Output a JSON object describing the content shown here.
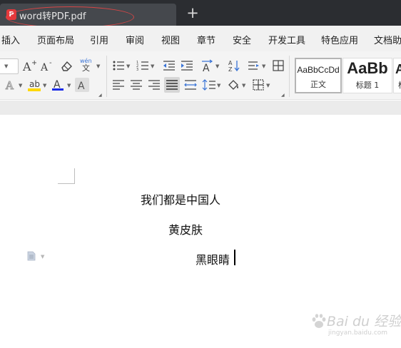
{
  "tab": {
    "icon_label": "P",
    "title": "word转PDF.pdf",
    "new_tab_symbol": "+"
  },
  "menu": [
    "插入",
    "页面布局",
    "引用",
    "审阅",
    "视图",
    "章节",
    "安全",
    "开发工具",
    "特色应用",
    "文档助手"
  ],
  "toolbar": {
    "phonetic_label": "wén",
    "styles": [
      {
        "preview": "AaBbCcDd",
        "name": "正文"
      },
      {
        "preview": "AaBb",
        "name": "标题 1"
      },
      {
        "preview": "Aa",
        "name": "标"
      }
    ]
  },
  "document": {
    "paragraphs": [
      "我们都是中国人",
      "黄皮肤",
      "黑眼睛"
    ]
  },
  "watermark": {
    "text": "Bai du 经验",
    "url": "jingyan.baidu.com"
  },
  "colors": {
    "tab_bar": "#2b2d31",
    "active_tab": "#45484d",
    "pdf_icon": "#e5383b",
    "annotation": "#d94545",
    "highlight_color": "#ffd800",
    "font_color": "#1a2be8"
  }
}
